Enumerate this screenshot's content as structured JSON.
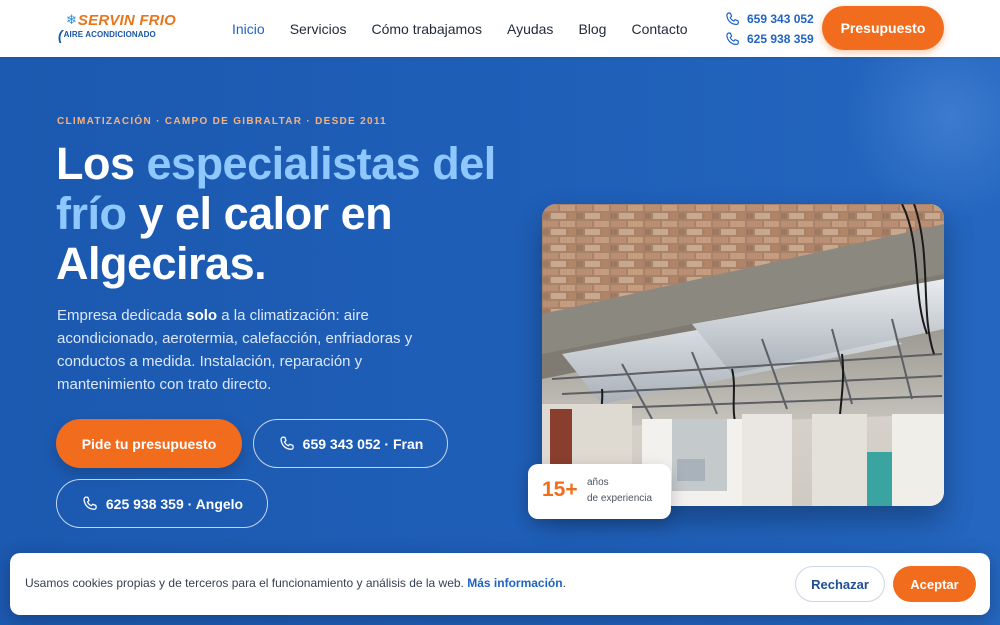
{
  "header": {
    "logo": {
      "line1": "SERVIN FRIO",
      "line2": "AIRE ACONDICIONADO",
      "icon": "snowflake-icon"
    },
    "nav": [
      {
        "label": "Inicio",
        "active": true
      },
      {
        "label": "Servicios",
        "active": false
      },
      {
        "label": "Cómo trabajamos",
        "active": false
      },
      {
        "label": "Ayudas",
        "active": false
      },
      {
        "label": "Blog",
        "active": false
      },
      {
        "label": "Contacto",
        "active": false
      }
    ],
    "phones": [
      "659 343 052",
      "625 938 359"
    ],
    "cta_label": "Presupuesto"
  },
  "hero": {
    "eyebrow": "CLIMATIZACIÓN · CAMPO DE GIBRALTAR · DESDE 2011",
    "headline": {
      "part1": "Los ",
      "highlight1": "especialistas del frío",
      "part2": " y el calor en Algeciras."
    },
    "lead": {
      "before": "Empresa dedicada ",
      "bold": "solo",
      "after": " a la climatización: aire acondicionado, aerotermia, calefacción, enfriadoras y conductos a medida. Instalación, reparación y mantenimiento con trato directo."
    },
    "buttons": {
      "primary": "Pide tu presupuesto",
      "phone_fran": "659 343 052 · Fran",
      "phone_angelo": "625 938 359 · Angelo"
    },
    "badge": {
      "number": "15+",
      "line1": "años",
      "line2": "de experiencia"
    }
  },
  "cookie": {
    "text": "Usamos cookies propias y de terceros para el funcionamiento y análisis de la web.",
    "link": "Más información",
    "reject": "Rechazar",
    "accept": "Aceptar"
  },
  "colors": {
    "brand_blue": "#1f5fb8",
    "accent_orange": "#f26c1d",
    "highlight_blue": "#8ec8ff",
    "eyebrow_peach": "#f7b27e"
  }
}
